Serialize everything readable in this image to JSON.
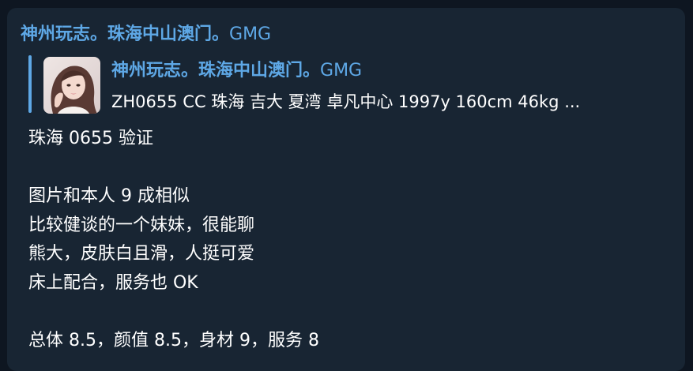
{
  "message": {
    "sender_name": "神州玩志。珠海中山澳门。",
    "sender_tag": "GMG",
    "reply": {
      "title_name": "神州玩志。珠海中山澳门。",
      "title_tag": "GMG",
      "preview": "ZH0655 CC 珠海 吉大 夏湾 卓凡中心 1997y  160cm  46kg ...",
      "thumbnail_icon": "profile-photo"
    },
    "lines": [
      "珠海 0655 验证",
      "",
      "图片和本人 9 成相似",
      "比较健谈的一个妹妹，很能聊",
      "熊大，皮肤白且滑，人挺可爱",
      "床上配合，服务也 OK",
      "",
      "总体 8.5，颜值 8.5，身材 9，服务 8"
    ]
  },
  "colors": {
    "window_bg": "#0e1621",
    "bubble_bg": "#182533",
    "accent": "#5ea8e6",
    "text": "#ffffff"
  }
}
